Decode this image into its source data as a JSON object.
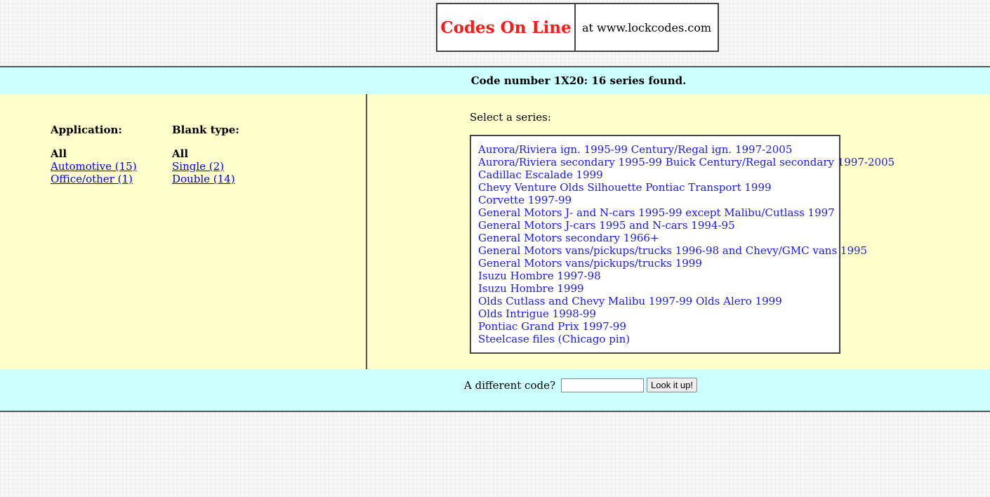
{
  "header": {
    "brand": "Codes On Line",
    "site": "at www.lockcodes.com"
  },
  "result": {
    "message": "Code number 1X20: 16 series found."
  },
  "filters": {
    "application": {
      "heading": "Application:",
      "current": "All",
      "links": [
        "Automotive (15)",
        "Office/other (1)"
      ]
    },
    "blank_type": {
      "heading": "Blank type:",
      "current": "All",
      "links": [
        "Single (2)",
        "Double (14)"
      ]
    }
  },
  "series": {
    "label": "Select a series:",
    "items": [
      "Aurora/Riviera ign. 1995-99 Century/Regal ign. 1997-2005",
      "Aurora/Riviera secondary 1995-99 Buick Century/Regal secondary 1997-2005",
      "Cadillac Escalade 1999",
      "Chevy Venture Olds Silhouette Pontiac Transport 1999",
      "Corvette 1997-99",
      "General Motors J- and N-cars 1995-99 except Malibu/Cutlass 1997",
      "General Motors J-cars 1995 and N-cars 1994-95",
      "General Motors secondary 1966+",
      "General Motors vans/pickups/trucks 1996-98 and Chevy/GMC vans 1995",
      "General Motors vans/pickups/trucks 1999",
      "Isuzu Hombre 1997-98",
      "Isuzu Hombre 1999",
      "Olds Cutlass and Chevy Malibu 1997-99 Olds Alero 1999",
      "Olds Intrigue 1998-99",
      "Pontiac Grand Prix 1997-99",
      "Steelcase files (Chicago pin)"
    ]
  },
  "lookup": {
    "label": "A different code?",
    "value": "",
    "button": "Look it up!"
  },
  "colors": {
    "brand": "#ff1a1a",
    "top_band": "#ccffff",
    "mid_band": "#ffffcc",
    "link": "#0000ee"
  }
}
